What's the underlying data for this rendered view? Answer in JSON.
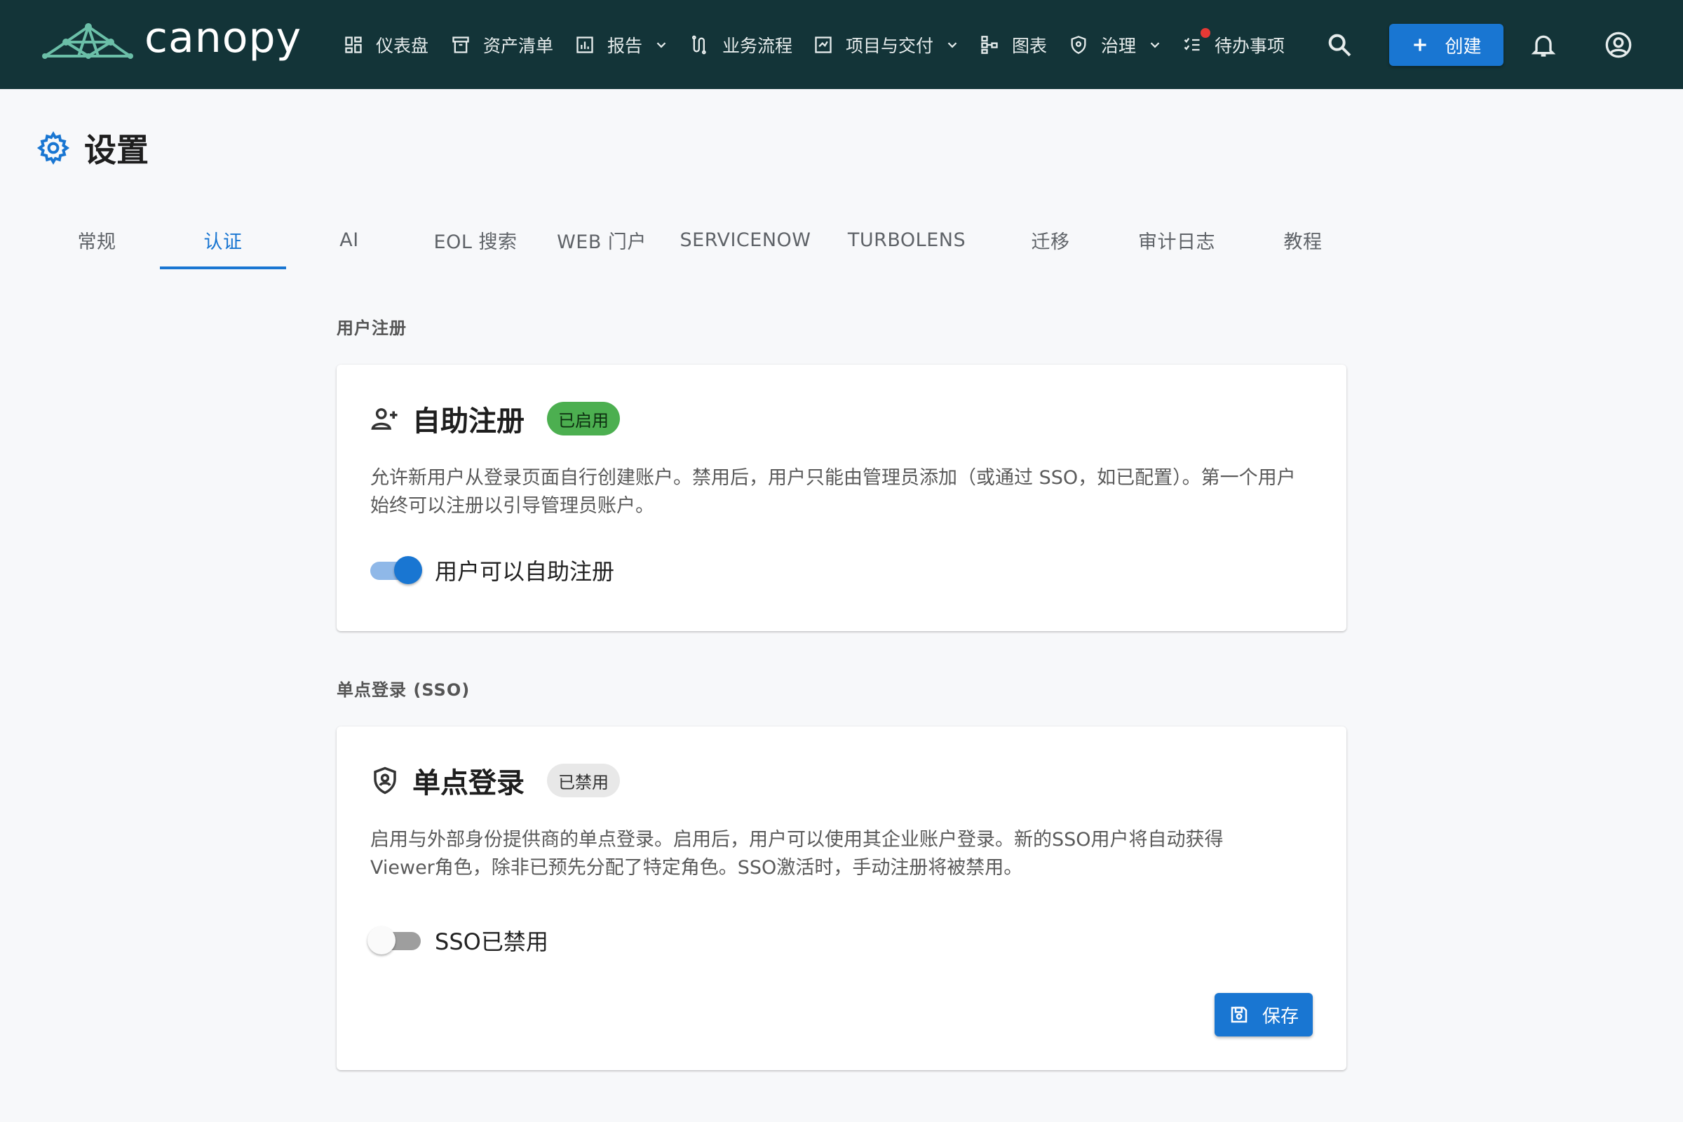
{
  "colors": {
    "appbar_bg": "#133438",
    "accent": "#1976d2",
    "enabled_badge": "#4caf50",
    "disabled_badge": "#e8e8e8",
    "notification_dot": "#e53935"
  },
  "app": {
    "logo_icon": "canopy-tent-icon",
    "name": "canopy"
  },
  "nav": {
    "items": [
      {
        "label": "仪表盘",
        "icon": "dashboard-icon"
      },
      {
        "label": "资产清单",
        "icon": "archive-box-icon"
      },
      {
        "label": "报告",
        "icon": "bar-chart-icon",
        "dropdown": true
      },
      {
        "label": "业务流程",
        "icon": "flow-icon"
      },
      {
        "label": "项目与交付",
        "icon": "project-icon",
        "dropdown": true
      },
      {
        "label": "图表",
        "icon": "hierarchy-icon"
      },
      {
        "label": "治理",
        "icon": "shield-icon",
        "dropdown": true
      },
      {
        "label": "待办事项",
        "icon": "checklist-icon",
        "has_notification": true
      }
    ],
    "search_icon": "search-icon",
    "create_label": "创建",
    "bell_icon": "bell-icon",
    "account_icon": "account-circle-icon"
  },
  "page": {
    "title": "设置",
    "title_icon": "gear-icon"
  },
  "tabs": [
    {
      "label": "常规",
      "active": false
    },
    {
      "label": "认证",
      "active": true
    },
    {
      "label": "AI",
      "active": false
    },
    {
      "label": "EOL 搜索",
      "active": false
    },
    {
      "label": "WEB 门户",
      "active": false
    },
    {
      "label": "SERVICENOW",
      "active": false
    },
    {
      "label": "TURBOLENS",
      "active": false
    },
    {
      "label": "迁移",
      "active": false
    },
    {
      "label": "审计日志",
      "active": false
    },
    {
      "label": "教程",
      "active": false
    }
  ],
  "registration": {
    "section_label": "用户注册",
    "icon": "person-add-icon",
    "title": "自助注册",
    "badge": "已启用",
    "description": "允许新用户从登录页面自行创建账户。禁用后，用户只能由管理员添加（或通过 SSO，如已配置）。第一个用户始终可以注册以引导管理员账户。",
    "toggle_label": "用户可以自助注册",
    "toggle_on": true
  },
  "sso": {
    "section_label": "单点登录 (SSO)",
    "icon": "shield-lock-icon",
    "title": "单点登录",
    "badge": "已禁用",
    "description": "启用与外部身份提供商的单点登录。启用后，用户可以使用其企业账户登录。新的SSO用户将自动获得Viewer角色，除非已预先分配了特定角色。SSO激活时，手动注册将被禁用。",
    "toggle_label": "SSO已禁用",
    "toggle_on": false,
    "save_label": "保存",
    "save_icon": "save-icon"
  }
}
